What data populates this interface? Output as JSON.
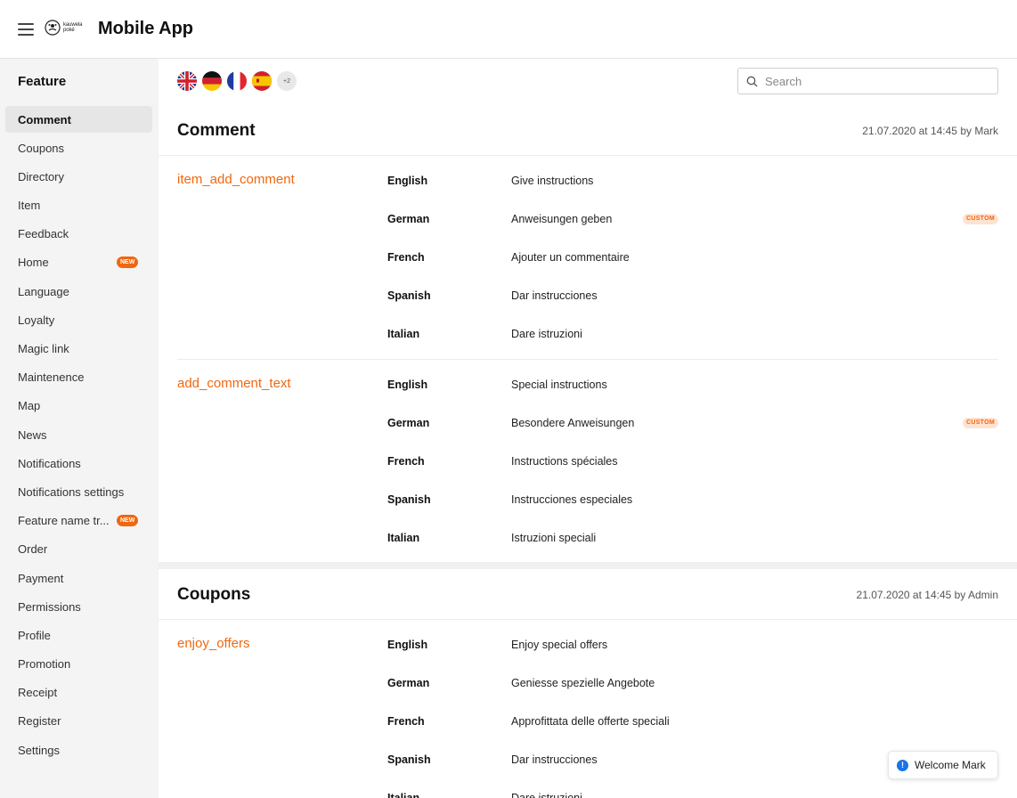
{
  "header": {
    "logo_text": "kauwela poké",
    "title": "Mobile App"
  },
  "sidebar": {
    "heading": "Feature",
    "items": [
      {
        "label": "Comment",
        "active": true
      },
      {
        "label": "Coupons"
      },
      {
        "label": "Directory"
      },
      {
        "label": "Item"
      },
      {
        "label": "Feedback"
      },
      {
        "label": "Home",
        "badge": "NEW"
      },
      {
        "label": "Language"
      },
      {
        "label": "Loyalty"
      },
      {
        "label": "Magic link"
      },
      {
        "label": "Maintenence"
      },
      {
        "label": "Map"
      },
      {
        "label": "News"
      },
      {
        "label": "Notifications"
      },
      {
        "label": "Notifications settings"
      },
      {
        "label": "Feature name tr...",
        "badge": "NEW"
      },
      {
        "label": "Order"
      },
      {
        "label": "Payment"
      },
      {
        "label": "Permissions"
      },
      {
        "label": "Profile"
      },
      {
        "label": "Promotion"
      },
      {
        "label": "Receipt"
      },
      {
        "label": "Register"
      },
      {
        "label": "Settings"
      }
    ]
  },
  "languages": {
    "flags": [
      "uk-flag-icon",
      "germany-flag-icon",
      "france-flag-icon",
      "spain-flag-icon"
    ],
    "more": "+2"
  },
  "search": {
    "placeholder": "Search",
    "value": ""
  },
  "sections": [
    {
      "title": "Comment",
      "meta": "21.07.2020 at 14:45 by Mark",
      "keys": [
        {
          "name": "item_add_comment",
          "rows": [
            {
              "lang": "English",
              "text": "Give instructions"
            },
            {
              "lang": "German",
              "text": "Anweisungen geben",
              "tag": "CUSTOM"
            },
            {
              "lang": "French",
              "text": "Ajouter un commentaire"
            },
            {
              "lang": "Spanish",
              "text": "Dar instrucciones"
            },
            {
              "lang": "Italian",
              "text": "Dare istruzioni"
            }
          ]
        },
        {
          "name": "add_comment_text",
          "rows": [
            {
              "lang": "English",
              "text": "Special instructions"
            },
            {
              "lang": "German",
              "text": "Besondere Anweisungen",
              "tag": "CUSTOM"
            },
            {
              "lang": "French",
              "text": "Instructions spéciales"
            },
            {
              "lang": "Spanish",
              "text": "Instrucciones especiales"
            },
            {
              "lang": "Italian",
              "text": "Istruzioni speciali"
            }
          ]
        }
      ]
    },
    {
      "title": "Coupons",
      "meta": "21.07.2020 at 14:45 by Admin",
      "keys": [
        {
          "name": "enjoy_offers",
          "rows": [
            {
              "lang": "English",
              "text": "Enjoy special offers"
            },
            {
              "lang": "German",
              "text": "Geniesse spezielle Angebote"
            },
            {
              "lang": "French",
              "text": "Approfittata delle offerte speciali"
            },
            {
              "lang": "Spanish",
              "text": "Dar instrucciones"
            },
            {
              "lang": "Italian",
              "text": "Dare istruzioni"
            }
          ]
        }
      ]
    }
  ],
  "toast": {
    "text": "Welcome Mark"
  },
  "colors": {
    "accent": "#f0670f",
    "sidebar_bg": "#f4f4f4",
    "info": "#1a73e8"
  }
}
